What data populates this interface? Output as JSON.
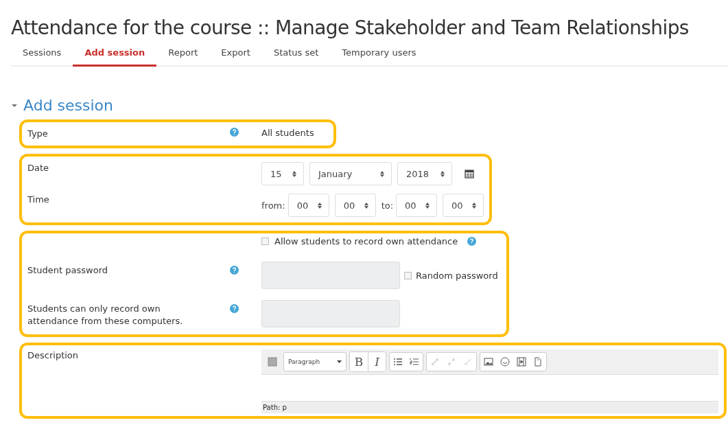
{
  "title": "Attendance for the course :: Manage Stakeholder and Team Relationships",
  "tabs": [
    {
      "label": "Sessions",
      "selected": false
    },
    {
      "label": "Add session",
      "selected": true
    },
    {
      "label": "Report",
      "selected": false
    },
    {
      "label": "Export",
      "selected": false
    },
    {
      "label": "Status set",
      "selected": false
    },
    {
      "label": "Temporary users",
      "selected": false
    }
  ],
  "section": {
    "title": "Add session",
    "expanded": true
  },
  "groups": [
    {
      "rows": [
        {
          "kind": "static",
          "label": "Type",
          "help": true,
          "value": "All students"
        }
      ]
    },
    {
      "rows": [
        {
          "kind": "selects",
          "label": "Date",
          "selects": [
            {
              "value": "15"
            },
            {
              "value": "January"
            },
            {
              "value": "2018"
            }
          ],
          "calendar": true
        },
        {
          "kind": "selects",
          "label": "Time",
          "parts": [
            {
              "text": "from:",
              "selects": [
                {
                  "value": "00"
                },
                {
                  "value": "00"
                }
              ]
            },
            {
              "text": "to:",
              "selects": [
                {
                  "value": "00"
                },
                {
                  "value": "00"
                }
              ]
            }
          ]
        }
      ]
    },
    {
      "rows": [
        {
          "kind": "checkbox",
          "label_text": "Allow students to record own attendance",
          "checked": false,
          "help": true
        },
        {
          "kind": "input",
          "label": "Student password",
          "help": true,
          "checkbox": {
            "text": "Random password",
            "checked": false
          }
        },
        {
          "kind": "input",
          "label": "Students can only record own attendance from these computers.",
          "help": true
        }
      ]
    },
    {
      "wide": true,
      "rows": [
        {
          "kind": "editor",
          "label": "Description",
          "format": "Paragraph",
          "bold": "B",
          "italic": "I",
          "path": "Path: p"
        }
      ]
    }
  ]
}
